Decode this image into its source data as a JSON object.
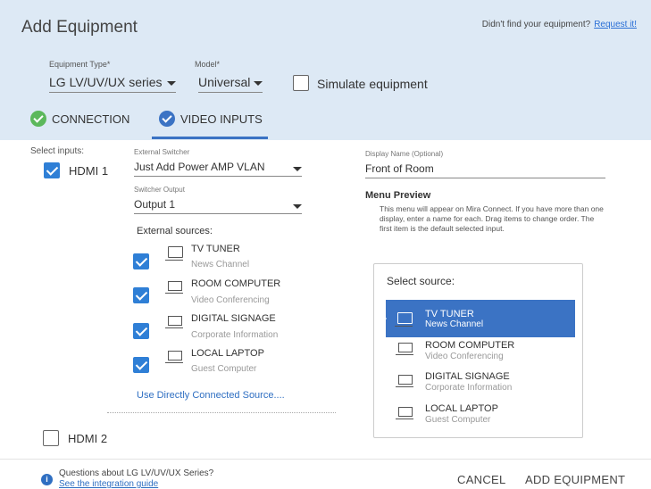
{
  "header": {
    "title": "Add Equipment",
    "didnt_find": "Didn't find your equipment?",
    "request_link": "Request it!"
  },
  "form": {
    "type_label": "Equipment Type*",
    "type_value": "LG LV/UV/UX series",
    "model_label": "Model*",
    "model_value": "Universal",
    "simulate_label": "Simulate equipment"
  },
  "tabs": [
    {
      "label": "CONNECTION",
      "color": "#5cb85c"
    },
    {
      "label": "VIDEO INPUTS",
      "color": "#3b73c4"
    }
  ],
  "inputs": {
    "select_label": "Select inputs:",
    "hdmi1": "HDMI 1",
    "hdmi2": "HDMI 2",
    "switcher_label": "External Switcher",
    "switcher_value": "Just Add Power AMP VLAN",
    "output_label": "Switcher Output",
    "output_value": "Output 1",
    "sources_heading": "External sources:",
    "sources": [
      {
        "name": "TV TUNER",
        "sub": "News Channel",
        "icon": "tv-icon"
      },
      {
        "name": "ROOM COMPUTER",
        "sub": "Video Conferencing",
        "icon": "laptop-icon"
      },
      {
        "name": "DIGITAL SIGNAGE",
        "sub": "Corporate Information",
        "icon": "laptop-icon"
      },
      {
        "name": "LOCAL LAPTOP",
        "sub": "Guest Computer",
        "icon": "laptop-icon"
      }
    ],
    "direct_link": "Use Directly Connected Source...."
  },
  "display": {
    "name_label": "Display Name (Optional)",
    "name_value": "Front of Room",
    "menu_heading": "Menu Preview",
    "menu_desc": "This menu will appear on Mira Connect.  If you have more than one display, enter a name for each.  Drag items to change order. The first item is the default selected input.",
    "preview_title": "Select source:"
  },
  "footer": {
    "question": "Questions about LG LV/UV/UX Series?",
    "guide_link": "See the integration guide",
    "cancel": "CANCEL",
    "add": "ADD EQUIPMENT"
  },
  "colors": {
    "accent": "#3b73c4",
    "header_bg": "#dde9f5",
    "check": "#2f7fd6",
    "success": "#5cb85c"
  }
}
